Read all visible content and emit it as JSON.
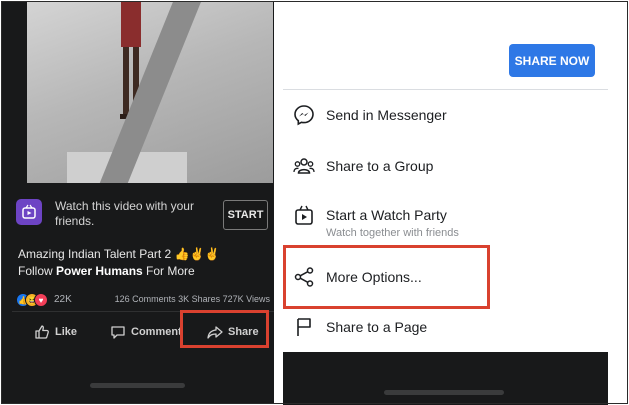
{
  "left_panel": {
    "watch_party": {
      "text": "Watch this video with your friends.",
      "start_label": "START"
    },
    "caption": {
      "line1": "Amazing Indian Talent  Part 2",
      "emojis": "👍✌️✌️",
      "line2_prefix": "Follow ",
      "page_name": "Power Humans",
      "line2_suffix": " For More"
    },
    "stats": {
      "reaction_count": "22K",
      "summary": "126 Comments  3K Shares  727K Views"
    },
    "actions": {
      "like": "Like",
      "comment": "Comment",
      "share": "Share"
    }
  },
  "right_panel": {
    "share_now_label": "SHARE NOW",
    "options": [
      {
        "label": "Send in Messenger",
        "icon": "messenger-icon"
      },
      {
        "label": "Share to a Group",
        "icon": "group-icon"
      },
      {
        "label": "Start a Watch Party",
        "sub": "Watch together with friends",
        "icon": "watch-party-icon"
      },
      {
        "label": "More Options...",
        "icon": "share-nodes-icon"
      },
      {
        "label": "Share to a Page",
        "icon": "flag-icon"
      }
    ]
  },
  "colors": {
    "highlight": "#d9412f",
    "share_now_bg": "#2e78e6",
    "dark_bg": "#18191a",
    "watch_icon_bg": "#6d44c4"
  }
}
